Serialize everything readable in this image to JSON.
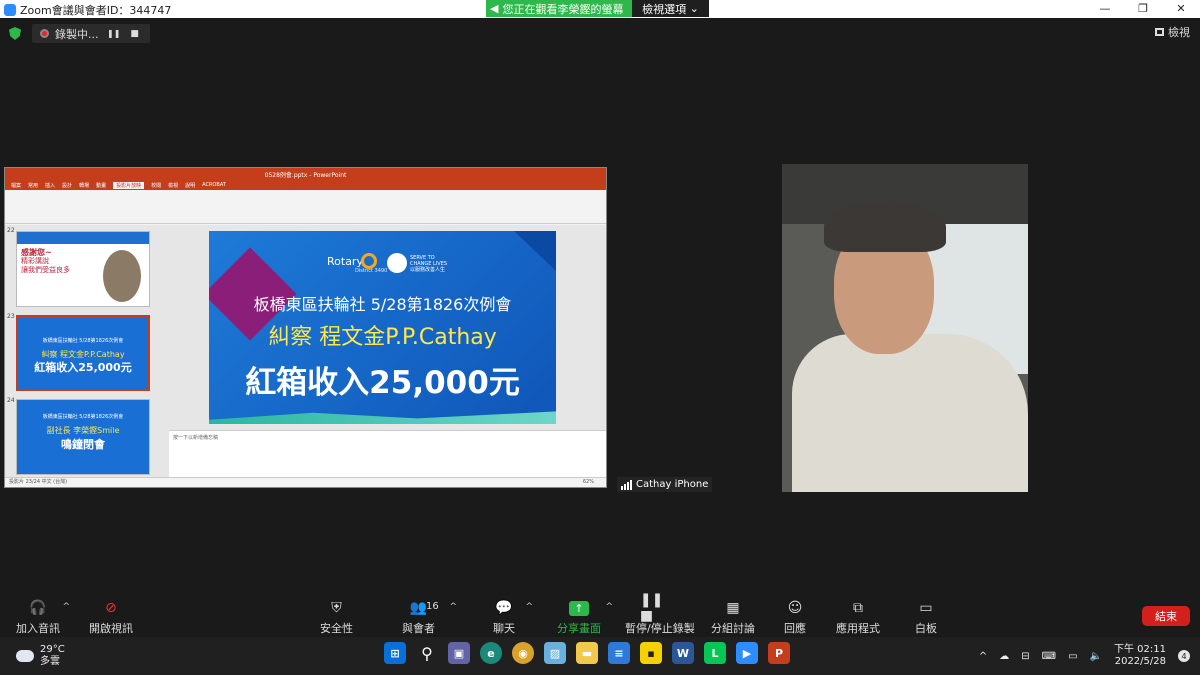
{
  "window": {
    "title": "Zoom會議與會者ID：344747",
    "share_banner": "您正在觀看李榮鏗的螢幕",
    "view_options": "檢視選項",
    "minimize": "—",
    "restore": "❐",
    "close": "✕"
  },
  "recording": {
    "label": "錄製中...",
    "pause": "❚❚",
    "stop": "■"
  },
  "view_button": "檢視",
  "shared_screen": {
    "app_title": "0528例會.pptx - PowerPoint",
    "tabs": [
      "檔案",
      "常用",
      "插入",
      "設計",
      "轉場",
      "動畫",
      "投影片放映",
      "校閱",
      "檢視",
      "說明",
      "ACROBAT"
    ],
    "active_tab": "投影片放映",
    "thumbnails": [
      {
        "num": "22",
        "line1": "感謝您~",
        "line2": "精彩講說",
        "line3": "讓我們受益良多"
      },
      {
        "num": "23",
        "line1": "板橋東區扶輪社 5/28第1826次例會",
        "line2": "糾察 程文金P.P.Cathay",
        "line3": "紅箱收入25,000元"
      },
      {
        "num": "24",
        "line1": "板橋東區扶輪社 5/28第1826次例會",
        "line2": "副社長 李榮鏗Smile",
        "line3": "鳴鐘閉會"
      }
    ],
    "slide": {
      "brand": "Rotary",
      "district": "District 3490",
      "slogan1": "SERVE TO",
      "slogan2": "CHANGE LIVES",
      "slogan3": "以服務改善人生",
      "title": "板橋東區扶輪社 5/28第1826次例會",
      "subtitle": "糾察 程文金P.P.Cathay",
      "amount": "紅箱收入25,000元"
    },
    "notes_placeholder": "按一下以新增備忘稿",
    "status": "投影片 23/24   中文 (台灣)",
    "zoom_level": "62%"
  },
  "participant": {
    "name": "Cathay iPhone"
  },
  "toolbar": {
    "audio": "加入音訊",
    "video": "開啟視訊",
    "security": "安全性",
    "participants": "與會者",
    "participant_count": "16",
    "chat": "聊天",
    "share": "分享畫面",
    "record": "暫停/停止錄製",
    "breakout": "分組討論",
    "reactions": "回應",
    "apps": "應用程式",
    "whiteboard": "白板",
    "end": "結束"
  },
  "taskbar": {
    "temperature": "29°C",
    "weather": "多雲",
    "time": "下午 02:11",
    "date": "2022/5/28",
    "notifications": "4"
  },
  "colors": {
    "share_green": "#2eb84b",
    "end_red": "#d4201c",
    "ppt_red": "#c43e1c",
    "slide_blue": "#1e7ad8"
  }
}
